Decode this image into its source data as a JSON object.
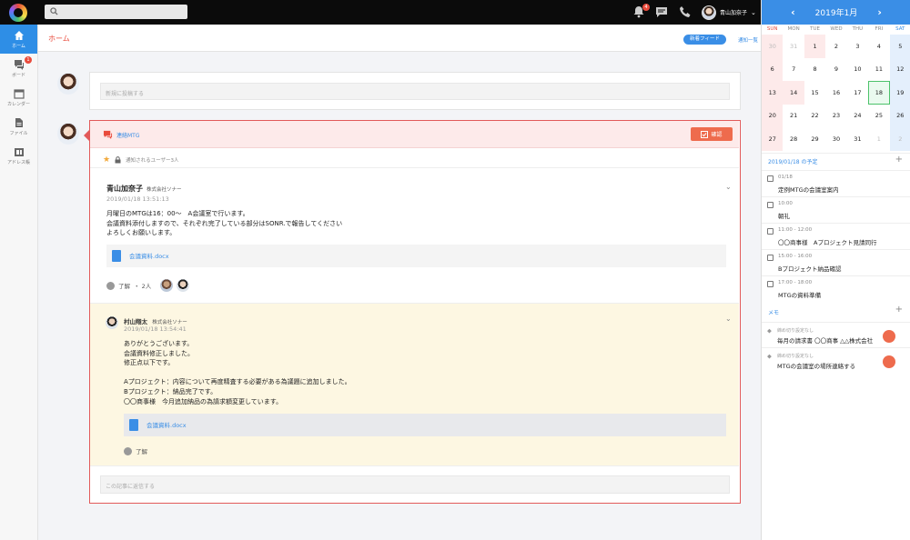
{
  "topbar": {
    "search_placeholder": "",
    "notification_count": "4",
    "user_name": "青山加奈子"
  },
  "sidebar": {
    "items": [
      {
        "label": "ホーム",
        "icon": "home-icon"
      },
      {
        "label": "ボード",
        "icon": "board-icon",
        "badge": "1"
      },
      {
        "label": "カレンダー",
        "icon": "calendar-icon"
      },
      {
        "label": "ファイル",
        "icon": "file-icon"
      },
      {
        "label": "アドレス帳",
        "icon": "address-book-icon"
      }
    ]
  },
  "header": {
    "title": "ホーム",
    "feed_tab": "新着フィード",
    "notify_tab": "通知一覧"
  },
  "new_post": {
    "placeholder": "新規に投稿する"
  },
  "post": {
    "category": "連絡MTG",
    "confirm_label": "確認",
    "notice": "通知されるユーザー3人",
    "author": "青山加奈子",
    "company": "株式会社ソナー",
    "time": "2019/01/18 13:51:13",
    "body": "月曜日のMTGは16：00〜　A会議室で行います。\n会議資料添付しますので、それぞれ完了している部分はSONR.で報告してください\nよろしくお願いします。",
    "file": "会議資料.docx",
    "ack_label": "了解",
    "ack_count": "・ 2人"
  },
  "reply": {
    "author": "村山翔太",
    "company": "株式会社ソナー",
    "time": "2019/01/18 13:54:41",
    "body": "ありがとうございます。\n会議資料修正しました。\n修正点以下です。\n\nAプロジェクト：内容について再度精査する必要がある為議題に追加しました。\nBプロジェクト：納品完了です。\n〇〇商事様　今月追加納品の為請求額変更しています。",
    "file": "会議資料.docx",
    "ack_label": "了解",
    "placeholder": "この記事に返信する"
  },
  "calendar": {
    "month": "2019年1月",
    "prev": "‹",
    "next": "›",
    "dow": [
      "SUN",
      "MON",
      "TUE",
      "WED",
      "THU",
      "FRI",
      "SAT"
    ],
    "weeks": [
      [
        "30",
        "31",
        "1",
        "2",
        "3",
        "4",
        "5"
      ],
      [
        "6",
        "7",
        "8",
        "9",
        "10",
        "11",
        "12"
      ],
      [
        "13",
        "14",
        "15",
        "16",
        "17",
        "18",
        "19"
      ],
      [
        "20",
        "21",
        "22",
        "23",
        "24",
        "25",
        "26"
      ],
      [
        "27",
        "28",
        "29",
        "30",
        "31",
        "1",
        "2"
      ]
    ],
    "today": "18",
    "schedule_title": "2019/01/18 の予定",
    "schedule": [
      {
        "time": "01/18",
        "name": "定例MTGの会議室案内"
      },
      {
        "time": "10:00",
        "name": "朝礼"
      },
      {
        "time": "11:00 - 12:00",
        "name": "〇〇商事様　Aプロジェクト見請同行"
      },
      {
        "time": "15:00 - 16:00",
        "name": "Bプロジェクト納品確認"
      },
      {
        "time": "17:00 - 18:00",
        "name": "MTGの資料準備"
      }
    ],
    "memo_title": "メモ",
    "memos": [
      {
        "label": "締め切り設定なし",
        "text": "毎月の請求書 〇〇商事 △△株式会社"
      },
      {
        "label": "締め切り設定なし",
        "text": "MTGの会議室の場所連絡する"
      }
    ]
  },
  "colors": {
    "accent": "#3a8ee6",
    "danger": "#e94b3c",
    "confirm": "#ee6b4d"
  }
}
